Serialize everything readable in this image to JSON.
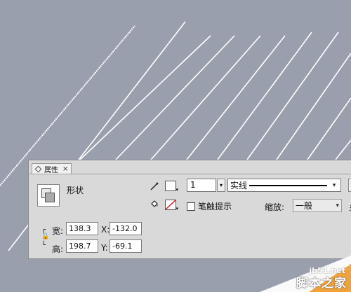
{
  "panel": {
    "tab_title": "属性",
    "tab_close": "×",
    "object_type": "形状",
    "stroke": {
      "height_value": "1",
      "style_value": "实线"
    },
    "hint_checkbox_label": "笔触提示",
    "hint_checked": false,
    "scale_label": "缩放:",
    "scale_value": "一般",
    "cut_text": "乡",
    "dimensions": {
      "width_label": "宽:",
      "width_value": "138.3",
      "height_label": "高:",
      "height_value": "198.7",
      "x_label": "X:",
      "x_value": "-132.0",
      "y_label": "Y:",
      "y_value": "-69.1"
    },
    "icons": {
      "stroke_color": "pencil-icon",
      "fill_color": "paint-bucket-icon",
      "lock": "lock-icon"
    },
    "stroke_swatch_color": "#ffffff",
    "fill_swatch": "none"
  },
  "watermark": {
    "url": "jb51.net",
    "name": "脚本之家"
  },
  "colors": {
    "canvas": "#9a9fad",
    "panel": "#d9d9d9",
    "lines": "#ffffff",
    "watermark_accent": "#f2a23a"
  }
}
